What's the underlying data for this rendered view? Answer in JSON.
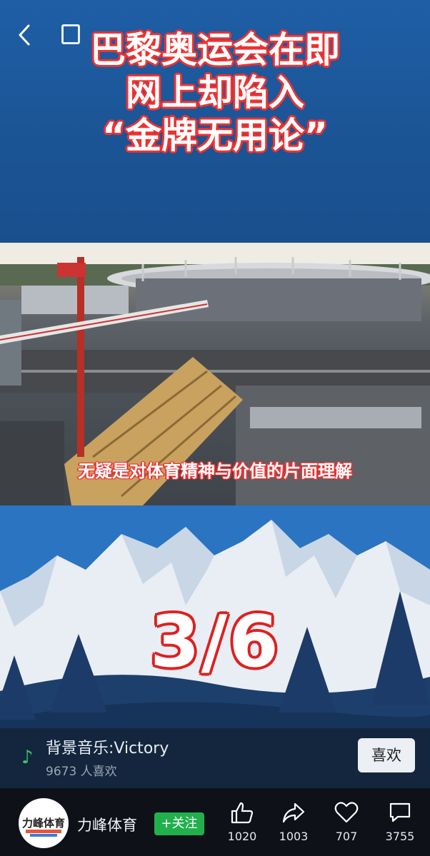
{
  "header": {
    "back_icon": "chevron-left-icon",
    "title_lines": [
      "巴黎奥运会在即",
      "网上却陷入",
      "“金牌无用论”"
    ]
  },
  "photo": {
    "caption": "无疑是对体育精神与价值的片面理解"
  },
  "slide": {
    "counter": "3/6"
  },
  "music": {
    "icon": "music-note-icon",
    "title": "背景音乐:Victory",
    "likes": "9673 人喜欢",
    "like_button": "喜欢"
  },
  "author": {
    "avatar_text": "力峰体育",
    "name": "力峰体育",
    "follow_label": "+关注"
  },
  "actions": {
    "like_count": "1020",
    "share_count": "1003",
    "favorite_count": "707",
    "comment_count": "3755"
  },
  "colors": {
    "top_blue": "#1f5ea6",
    "mountain_blue": "#2a74c2",
    "accent_red": "#e33333",
    "follow_green": "#22b04d",
    "note_green": "#3fc56a"
  }
}
